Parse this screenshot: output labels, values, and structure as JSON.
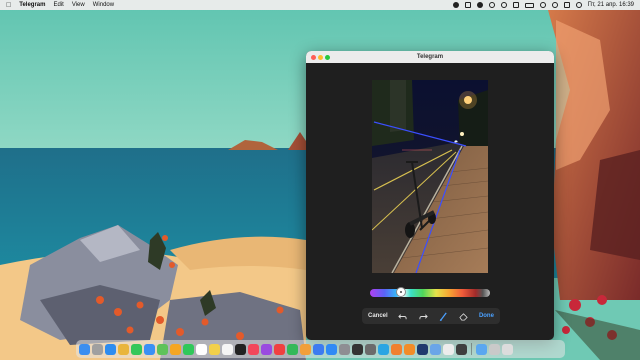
{
  "menubar": {
    "apple": "",
    "app": "Telegram",
    "menus": [
      "Edit",
      "View",
      "Window"
    ],
    "datetime": "Пт, 21 апр.  16:39"
  },
  "window": {
    "title": "Telegram"
  },
  "editor": {
    "cancel_label": "Cancel",
    "done_label": "Done",
    "undo_icon": "undo-icon",
    "redo_icon": "redo-icon",
    "brush_icon": "brush-icon",
    "eraser_icon": "eraser-icon",
    "palette_selected_color": "#ffffff",
    "accent": "#4aa0ff"
  },
  "dock": {
    "apps": [
      {
        "name": "finder-icon",
        "color": "#3b8ef0"
      },
      {
        "name": "launchpad-icon",
        "color": "#a0a0a0"
      },
      {
        "name": "safari-icon",
        "color": "#2d8cf0"
      },
      {
        "name": "chrome-icon",
        "color": "#e9b53c"
      },
      {
        "name": "messages-icon",
        "color": "#35c759"
      },
      {
        "name": "mail-icon",
        "color": "#3b90f5"
      },
      {
        "name": "maps-icon",
        "color": "#5fc25a"
      },
      {
        "name": "photos-icon",
        "color": "#f5a623"
      },
      {
        "name": "facetime-icon",
        "color": "#30c85a"
      },
      {
        "name": "calendar-icon",
        "color": "#ffffff"
      },
      {
        "name": "notes-icon",
        "color": "#f2d04a"
      },
      {
        "name": "reminders-icon",
        "color": "#f5f5f5"
      },
      {
        "name": "appletv-icon",
        "color": "#222222"
      },
      {
        "name": "music-icon",
        "color": "#f2475b"
      },
      {
        "name": "podcasts-icon",
        "color": "#9a4ae0"
      },
      {
        "name": "news-icon",
        "color": "#f04040"
      },
      {
        "name": "numbers-icon",
        "color": "#34b85a"
      },
      {
        "name": "pages-icon",
        "color": "#f29f3a"
      },
      {
        "name": "keynote-icon",
        "color": "#3c7bf0"
      },
      {
        "name": "appstore-icon",
        "color": "#2f8af5"
      },
      {
        "name": "settings-icon",
        "color": "#8e8e93"
      },
      {
        "name": "terminal-icon",
        "color": "#333333"
      },
      {
        "name": "screenshot-icon",
        "color": "#6b6b6b"
      },
      {
        "name": "telegram-icon",
        "color": "#2ba5e3"
      },
      {
        "name": "firefox-icon",
        "color": "#f08030"
      },
      {
        "name": "vlc-icon",
        "color": "#f28c28"
      },
      {
        "name": "photoshop-icon",
        "color": "#1f3a6e"
      },
      {
        "name": "preview-icon",
        "color": "#6aa5e8"
      },
      {
        "name": "textedit-icon",
        "color": "#ececec"
      },
      {
        "name": "activity-icon",
        "color": "#3f3f3f"
      }
    ],
    "trailing": [
      {
        "name": "downloads-folder-icon",
        "color": "#5aa7f0"
      },
      {
        "name": "documents-folder-icon",
        "color": "#c9c9c9"
      },
      {
        "name": "trash-icon",
        "color": "#dcdcdc"
      }
    ]
  }
}
